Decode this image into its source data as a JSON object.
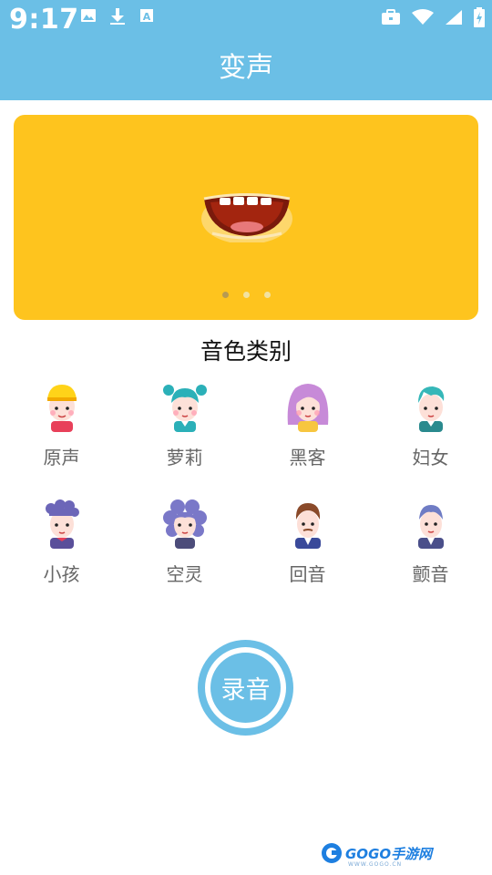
{
  "status_bar": {
    "time": "9:17",
    "left_icons": [
      "image-icon",
      "download-icon",
      "text-a-icon"
    ],
    "right_icons": [
      "briefcase-icon",
      "wifi-icon",
      "signal-icon",
      "battery-charging-icon"
    ]
  },
  "app_bar": {
    "title": "变声"
  },
  "banner": {
    "image": "mouth-icon",
    "slides": 3,
    "active_slide": 0,
    "background": "#fec41e"
  },
  "section": {
    "title": "音色类别"
  },
  "voices": [
    {
      "label": "原声",
      "icon": "boy-yellow-hair-icon"
    },
    {
      "label": "萝莉",
      "icon": "girl-teal-buns-icon"
    },
    {
      "label": "黑客",
      "icon": "girl-purple-hair-icon"
    },
    {
      "label": "妇女",
      "icon": "woman-teal-hair-icon"
    },
    {
      "label": "小孩",
      "icon": "kid-purple-hair-icon"
    },
    {
      "label": "空灵",
      "icon": "woman-curly-purple-icon"
    },
    {
      "label": "回音",
      "icon": "man-brown-hair-icon"
    },
    {
      "label": "颤音",
      "icon": "man-suit-icon"
    }
  ],
  "record_button": {
    "label": "录音"
  },
  "watermark": {
    "text": "GOGO手游网",
    "sub": "WWW.GOGO.CN"
  },
  "colors": {
    "accent": "#6bbfe6",
    "banner": "#fec41e"
  }
}
